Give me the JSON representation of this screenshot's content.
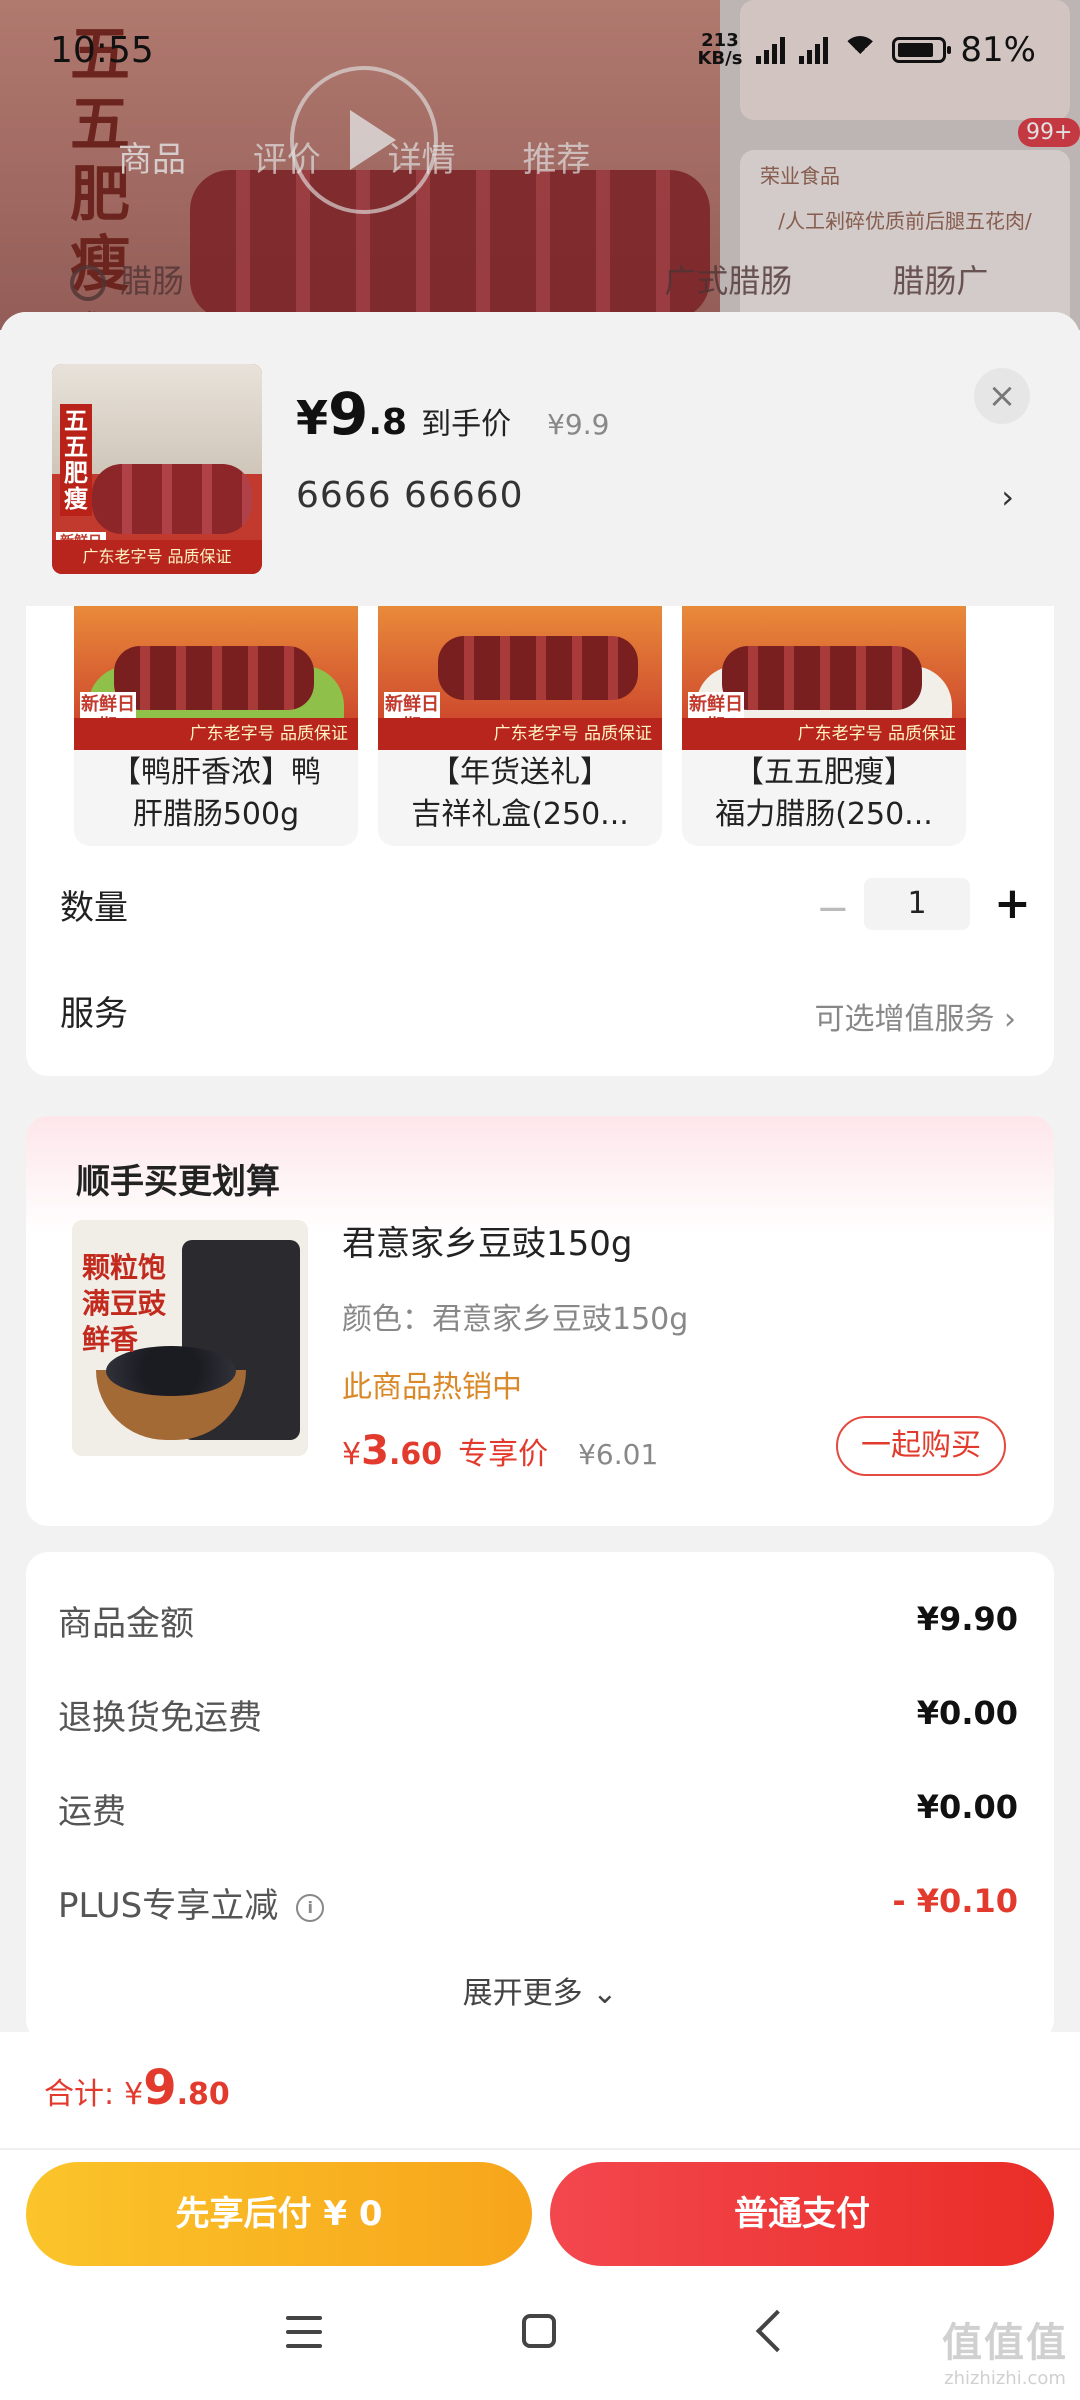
{
  "status_bar": {
    "time": "10:55",
    "net_speed_value": "213",
    "net_speed_unit": "KB/s",
    "battery": "81%"
  },
  "background": {
    "badge": "99+",
    "tabs": [
      "商品",
      "评价",
      "详情",
      "推荐"
    ],
    "search_chips": [
      "腊肠",
      "广式腊肠",
      "腊肠广式"
    ],
    "brand": "荣业食品",
    "desc": "/人工剁碎优质前后腿五花肉/"
  },
  "sheet": {
    "price_currency": "¥",
    "price_integer": "9",
    "price_decimal": ".8",
    "price_label": "到手价",
    "price_original": "¥9.9",
    "spec_text": "6666  66660",
    "thumb": {
      "label": "五五肥瘦",
      "fresh": "新鲜日期",
      "footer": "广东老字号 品质保证"
    },
    "variants": [
      {
        "name_line1": "【鸭肝香浓】鸭",
        "name_line2": "肝腊肠500g",
        "fresh": "新鲜日期",
        "footer": "广东老字号 品质保证"
      },
      {
        "name_line1": "【年货送礼】",
        "name_line2": "吉祥礼盒(250...",
        "fresh": "新鲜日期",
        "footer": "广东老字号 品质保证"
      },
      {
        "name_line1": "【五五肥瘦】",
        "name_line2": "福力腊肠(250...",
        "fresh": "新鲜日期",
        "footer": "广东老字号 品质保证"
      }
    ],
    "quantity_label": "数量",
    "quantity_minus": "−",
    "quantity_value": "1",
    "quantity_plus": "+",
    "service_label": "服务",
    "service_hint": "可选增值服务 ›"
  },
  "bundle": {
    "title": "顺手买更划算",
    "image_text": "颗粒饱满豆豉鲜香",
    "name": "君意家乡豆豉150g",
    "color": "颜色：君意家乡豆豉150g",
    "hot": "此商品热销中",
    "price_currency": "¥",
    "price_integer": "3",
    "price_decimal": ".60",
    "price_tag": "专享价",
    "price_original": "¥6.01",
    "buy_button": "一起购买"
  },
  "summary": {
    "rows": [
      {
        "label": "商品金额",
        "value": "¥9.90"
      },
      {
        "label": "退换货免运费",
        "value": "¥0.00"
      },
      {
        "label": "运费",
        "value": "¥0.00"
      },
      {
        "label": "PLUS专享立减",
        "value": "- ¥0.10"
      }
    ],
    "expand": "展开更多 ⌄"
  },
  "footer": {
    "total_label": "合计:",
    "total_currency": "¥",
    "total_integer": "9",
    "total_decimal": ".80",
    "later_button": "先享后付 ¥ 0",
    "pay_button": "普通支付"
  },
  "watermark": {
    "top": "值值值",
    "bottom": "zhizhizhi.com"
  },
  "colors": {
    "accent_red": "#e23b2e",
    "accent_yellow": "#f7a51b",
    "hot_orange": "#d9892a"
  }
}
